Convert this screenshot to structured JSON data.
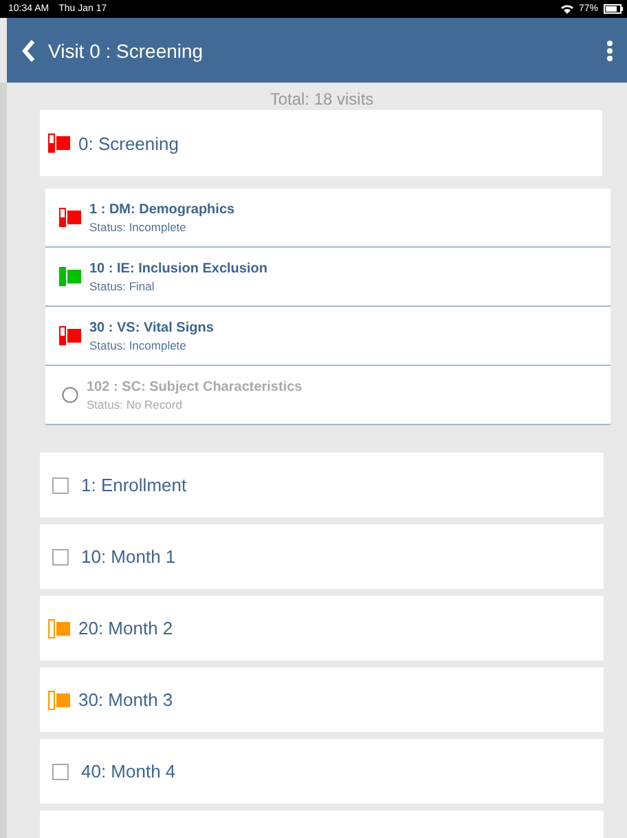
{
  "status_bar": {
    "time": "10:34 AM",
    "date": "Thu Jan 17",
    "battery": "77%"
  },
  "header": {
    "title": "Visit 0 : Screening"
  },
  "total": "Total: 18 visits",
  "current_visit": {
    "label": "0: Screening",
    "kind": "partial",
    "color": "#ff0000"
  },
  "forms": [
    {
      "title": "1 : DM: Demographics",
      "status": "Status:  Incomplete",
      "kind": "partial",
      "color": "#ff0000",
      "disabled": false
    },
    {
      "title": "10 : IE: Inclusion Exclusion",
      "status": "Status:  Final",
      "kind": "complete",
      "color": "#00c000",
      "disabled": false
    },
    {
      "title": "30 : VS: Vital Signs",
      "status": "Status:  Incomplete",
      "kind": "partial",
      "color": "#ff0000",
      "disabled": false
    },
    {
      "title": "102 : SC: Subject Characteristics",
      "status": "Status:  No Record",
      "kind": "circle",
      "disabled": true
    }
  ],
  "visits": [
    {
      "label": "1: Enrollment",
      "kind": "box"
    },
    {
      "label": "10: Month 1",
      "kind": "box"
    },
    {
      "label": "20: Month 2",
      "kind": "started",
      "color": "#ff9900"
    },
    {
      "label": "30: Month 3",
      "kind": "started",
      "color": "#ff9900"
    },
    {
      "label": "40: Month 4",
      "kind": "box"
    }
  ]
}
